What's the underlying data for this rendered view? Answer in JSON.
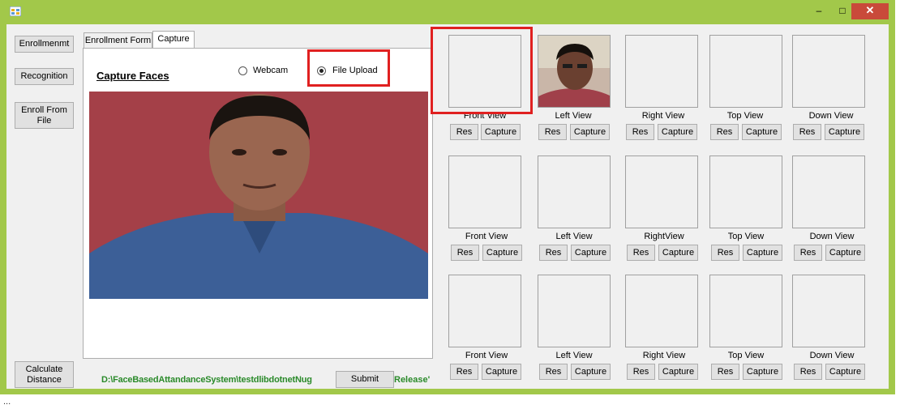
{
  "titlebar": {
    "minimize": "–",
    "maximize": "□",
    "close": "✕"
  },
  "left_buttons": {
    "enrollment": "Enrollmenmt",
    "recognition": "Recognition",
    "enroll_from_file": "Enroll From File",
    "calculate_distance": "Calculate Distance"
  },
  "tabs": [
    {
      "label": "Enrollment Form"
    },
    {
      "label": "Capture"
    }
  ],
  "capture": {
    "title": "Capture Faces",
    "radio_webcam": "Webcam",
    "radio_file_upload": "File Upload",
    "selected": "File Upload"
  },
  "path_text": "D:\\FaceBasedAttandanceSystem\\testdlibdotnetNug",
  "path_suffix": "Release'",
  "submit_label": "Submit",
  "views": {
    "row1": [
      "Front View",
      "Left View",
      "Right View",
      "Top View",
      "Down View"
    ],
    "row2": [
      "Front View",
      "Left View",
      "RightView",
      "Top View",
      "Down View"
    ],
    "row3": [
      "Front View",
      "Left View",
      "Right View",
      "Top View",
      "Down View"
    ]
  },
  "res_label": "Res",
  "capture_label": "Capture",
  "background_text": "...",
  "colors": {
    "titlebar": "#a2c84a",
    "close": "#c94a3a",
    "highlight": "#e02020",
    "path_text": "#2a8a2a"
  }
}
